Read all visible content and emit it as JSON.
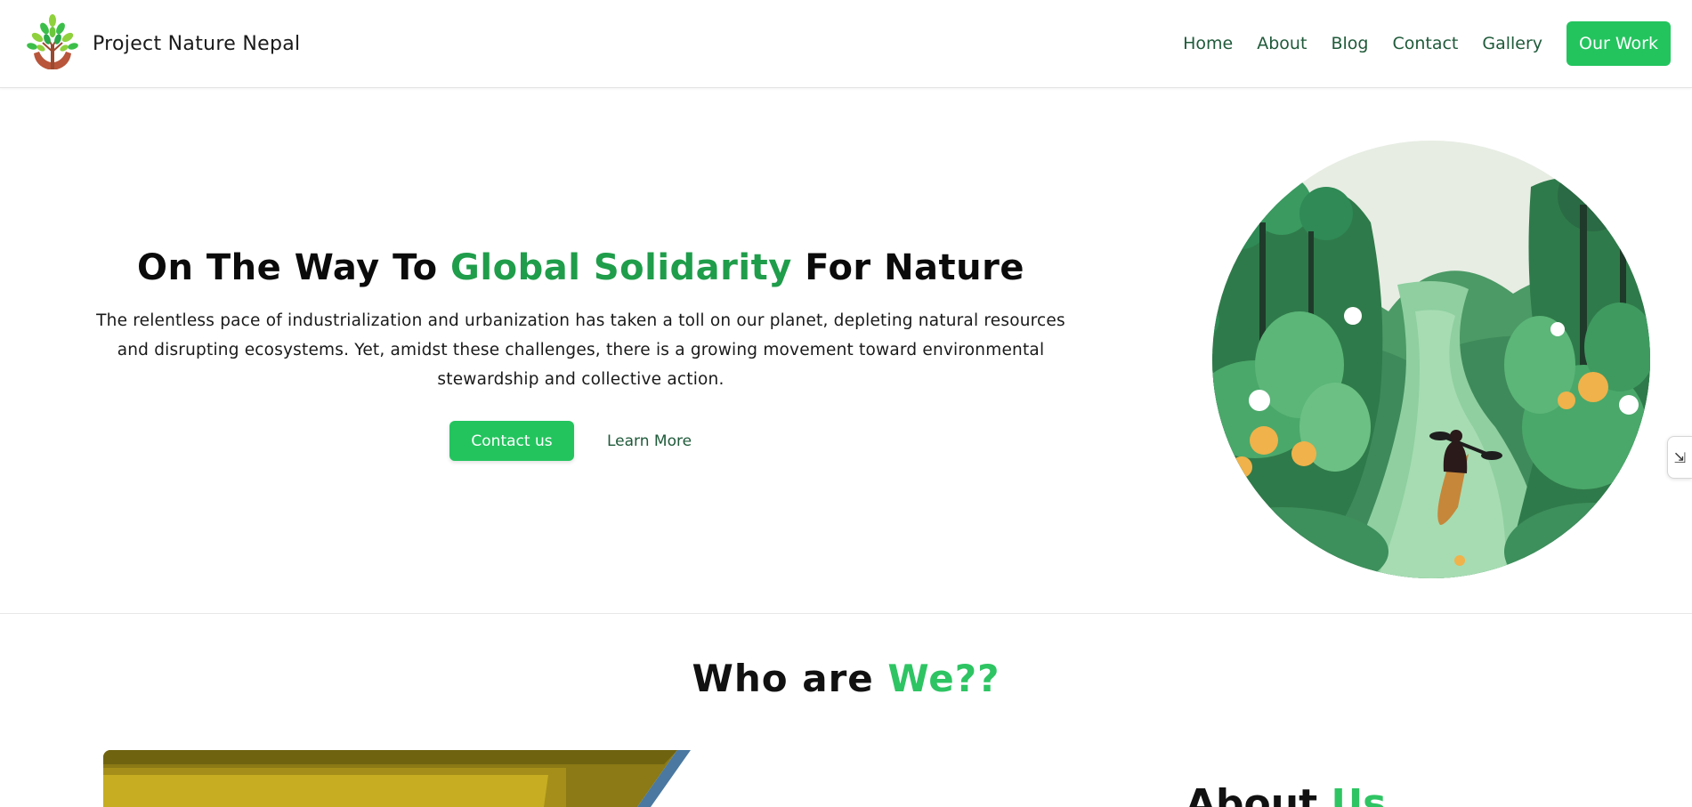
{
  "brand": {
    "name": "Project Nature Nepal",
    "logo_icon": "tree-hands-logo-icon"
  },
  "nav": {
    "items": [
      {
        "label": "Home"
      },
      {
        "label": "About"
      },
      {
        "label": "Blog"
      },
      {
        "label": "Contact"
      },
      {
        "label": "Gallery"
      }
    ],
    "cta_label": "Our Work"
  },
  "hero": {
    "title_before": "On The Way To ",
    "title_highlight": "Global Solidarity",
    "title_after": " For Nature",
    "description": "The relentless pace of industrialization and urbanization has taken a toll on our planet, depleting natural resources and disrupting ecosystems. Yet, amidst these challenges, there is a growing movement toward environmental stewardship and collective action.",
    "primary_button": "Contact us",
    "secondary_button": "Learn More",
    "illustration_icon": "river-kayak-illustration"
  },
  "side_tab_icon": "expand-icon",
  "who": {
    "title_before": "Who are ",
    "title_highlight": "We??"
  },
  "about": {
    "title_before": "About ",
    "title_highlight": "Us"
  },
  "colors": {
    "accent": "#23c45e",
    "accent_dark": "#1f9d4a",
    "nav_text": "#1f5a3a"
  }
}
